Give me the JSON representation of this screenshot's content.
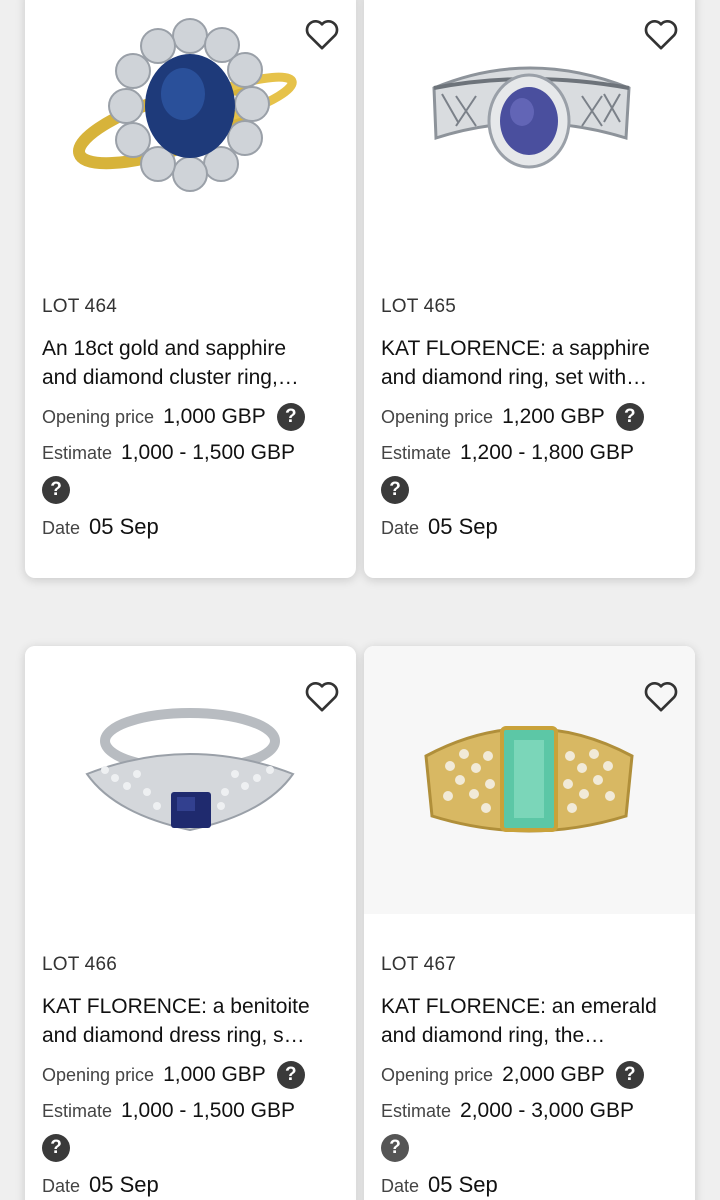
{
  "colors": {
    "background": "#efefef",
    "card": "#ffffff",
    "help_icon": "#3a3a3a"
  },
  "labels": {
    "opening_price": "Opening price",
    "estimate": "Estimate",
    "date": "Date",
    "help_icon": "?"
  },
  "lots": [
    {
      "lot": "LOT 464",
      "title_line1": "An 18ct gold and sapphire",
      "title_line2": "and diamond cluster ring,…",
      "opening_price": "1,000 GBP",
      "estimate": "1,000 - 1,500 GBP",
      "date": "05 Sep",
      "image": "sapphire-cluster-ring-image"
    },
    {
      "lot": "LOT 465",
      "title_line1": "KAT FLORENCE: a sapphire",
      "title_line2": "and diamond ring, set with…",
      "opening_price": "1,200 GBP",
      "estimate": "1,200 - 1,800 GBP",
      "date": "05 Sep",
      "image": "sapphire-halo-ring-image"
    },
    {
      "lot": "LOT 466",
      "title_line1": "KAT FLORENCE: a benitoite",
      "title_line2": "and diamond dress ring, s…",
      "opening_price": "1,000 GBP",
      "estimate": "1,000 - 1,500 GBP",
      "date": "05 Sep",
      "image": "benitoite-ring-image"
    },
    {
      "lot": "LOT 467",
      "title_line1": "KAT FLORENCE: an emerald",
      "title_line2": "and diamond ring, the…",
      "opening_price": "2,000 GBP",
      "estimate": "2,000 - 3,000 GBP",
      "date": "05 Sep",
      "image": "emerald-ring-image"
    }
  ]
}
